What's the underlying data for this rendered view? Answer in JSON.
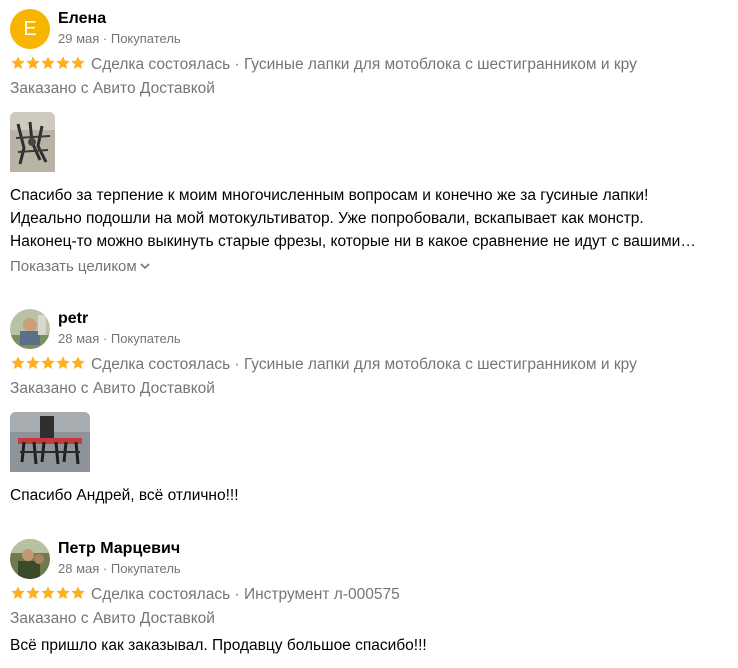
{
  "reviews": [
    {
      "avatar_letter": "Е",
      "author": "Елена",
      "date": "29 мая",
      "role": "Покупатель",
      "status": "Сделка состоялась",
      "item": "Гусиные лапки для мотоблока с шестигранником и кру",
      "delivery": "Заказано с Авито Доставкой",
      "text_lines": [
        "Спасибо за терпение к моим многочисленным вопросам и конечно же за гусиные лапки!",
        "Идеально подошли на мой мотокультиватор. Уже попробовали, вскапывает как монстр.",
        "Наконец-то можно выкинуть старые фрезы, которые ни в какое сравнение не идут с вашими…"
      ],
      "show_more": "Показать целиком"
    },
    {
      "author": "petr",
      "date": "28 мая",
      "role": "Покупатель",
      "status": "Сделка состоялась",
      "item": "Гусиные лапки для мотоблока с шестигранником и кру",
      "delivery": "Заказано с Авито Доставкой",
      "text_lines": [
        "Спасибо Андрей, всё отлично!!!"
      ]
    },
    {
      "author": "Петр Марцевич",
      "date": "28 мая",
      "role": "Покупатель",
      "status": "Сделка состоялась",
      "item": "Инструмент л-000575",
      "delivery": "Заказано с Авито Доставкой",
      "text_lines": [
        "Всё пришло как заказывал. Продавцу большое спасибо!!!"
      ]
    }
  ],
  "rating_stars": 5,
  "separator": " · ",
  "colors": {
    "star": "#ffb021",
    "avatar_letter_bg": "#f7b500",
    "muted_text": "#757575"
  }
}
